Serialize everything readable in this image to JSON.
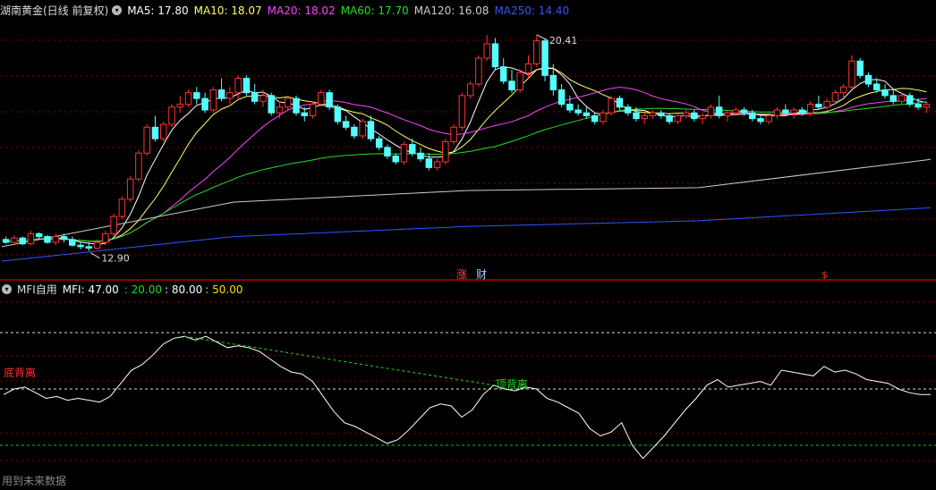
{
  "main_header": {
    "title": "湖南黄金(日线 前复权)",
    "ma": [
      {
        "label": "MA5: 17.80",
        "color": "#ffffff"
      },
      {
        "label": "MA10: 18.07",
        "color": "#ffff66"
      },
      {
        "label": "MA20: 18.02",
        "color": "#ff44ff"
      },
      {
        "label": "MA60: 17.70",
        "color": "#22dd22"
      },
      {
        "label": "MA120: 16.08",
        "color": "#cccccc"
      },
      {
        "label": "MA250: 14.40",
        "color": "#3355ff"
      }
    ]
  },
  "markers": {
    "high": "20.41",
    "low": "12.90",
    "tag_zhang": "涨",
    "tag_cai": "财",
    "tag_s": "$"
  },
  "mfi_header": {
    "name": "MFI自用",
    "mfi": "MFI: 47.00",
    "v1": ": 20.00",
    "v2": ": 80.00",
    "v3": ": 50.00",
    "colors": {
      "mfi": "#ffffff",
      "v1": "#22dd22",
      "v2": "#ffffff",
      "v3": "#ffdd00"
    }
  },
  "annotations": {
    "bottom_div": "底背离",
    "top_div": "顶背离"
  },
  "footer": "用到未来数据",
  "colors": {
    "up": "#ff3333",
    "down": "#55ffff",
    "grid": "#8b0000",
    "ma5": "#ffffff",
    "ma10": "#ffff66",
    "ma20": "#ff44ff",
    "ma60": "#22dd22",
    "ma120": "#cccccc",
    "ma250": "#3355ff"
  },
  "chart_data": [
    {
      "type": "candlestick",
      "candles": [
        [
          13.3,
          13.4,
          13.15,
          13.2
        ],
        [
          13.2,
          13.45,
          13.1,
          13.35
        ],
        [
          13.35,
          13.4,
          13.1,
          13.15
        ],
        [
          13.15,
          13.6,
          13.1,
          13.5
        ],
        [
          13.5,
          13.55,
          13.3,
          13.4
        ],
        [
          13.4,
          13.45,
          13.15,
          13.2
        ],
        [
          13.2,
          13.5,
          13.1,
          13.4
        ],
        [
          13.4,
          13.5,
          13.2,
          13.3
        ],
        [
          13.3,
          13.4,
          13.05,
          13.1
        ],
        [
          13.1,
          13.2,
          12.95,
          13.05
        ],
        [
          13.05,
          13.2,
          12.9,
          13.0
        ],
        [
          13.0,
          13.3,
          12.95,
          13.2
        ],
        [
          13.2,
          13.6,
          13.1,
          13.5
        ],
        [
          13.5,
          14.2,
          13.4,
          14.1
        ],
        [
          14.1,
          14.8,
          14.0,
          14.7
        ],
        [
          14.7,
          15.5,
          14.6,
          15.4
        ],
        [
          15.4,
          16.4,
          15.3,
          16.3
        ],
        [
          16.3,
          17.3,
          16.2,
          17.2
        ],
        [
          17.2,
          17.6,
          16.7,
          16.8
        ],
        [
          16.8,
          17.4,
          16.7,
          17.3
        ],
        [
          17.3,
          18.0,
          17.2,
          17.9
        ],
        [
          17.9,
          18.3,
          17.7,
          18.0
        ],
        [
          18.0,
          18.5,
          17.9,
          18.4
        ],
        [
          18.4,
          18.6,
          18.0,
          18.2
        ],
        [
          18.2,
          18.4,
          17.7,
          17.8
        ],
        [
          17.8,
          18.6,
          17.7,
          18.5
        ],
        [
          18.5,
          18.9,
          18.1,
          18.2
        ],
        [
          18.2,
          18.6,
          18.0,
          18.4
        ],
        [
          18.4,
          19.0,
          18.2,
          18.9
        ],
        [
          18.9,
          19.0,
          18.3,
          18.4
        ],
        [
          18.4,
          18.7,
          18.0,
          18.1
        ],
        [
          18.1,
          18.5,
          17.9,
          18.3
        ],
        [
          18.3,
          18.4,
          17.6,
          17.7
        ],
        [
          17.7,
          18.1,
          17.5,
          17.9
        ],
        [
          17.9,
          18.3,
          17.8,
          18.2
        ],
        [
          18.2,
          18.3,
          17.6,
          17.7
        ],
        [
          17.7,
          17.9,
          17.4,
          17.6
        ],
        [
          17.6,
          18.1,
          17.5,
          18.0
        ],
        [
          18.0,
          18.5,
          17.9,
          18.4
        ],
        [
          18.4,
          18.5,
          17.8,
          17.9
        ],
        [
          17.9,
          18.0,
          17.3,
          17.4
        ],
        [
          17.4,
          17.6,
          17.1,
          17.2
        ],
        [
          17.2,
          17.3,
          16.8,
          16.9
        ],
        [
          16.9,
          17.5,
          16.8,
          17.4
        ],
        [
          17.4,
          17.6,
          16.7,
          16.8
        ],
        [
          16.8,
          16.9,
          16.4,
          16.5
        ],
        [
          16.5,
          16.6,
          16.1,
          16.2
        ],
        [
          16.2,
          16.3,
          15.9,
          16.0
        ],
        [
          16.0,
          16.7,
          15.9,
          16.6
        ],
        [
          16.6,
          16.8,
          16.2,
          16.3
        ],
        [
          16.3,
          16.5,
          16.0,
          16.1
        ],
        [
          16.1,
          16.3,
          15.7,
          15.8
        ],
        [
          15.8,
          16.1,
          15.7,
          16.0
        ],
        [
          16.0,
          16.8,
          15.9,
          16.7
        ],
        [
          16.7,
          17.3,
          16.6,
          17.2
        ],
        [
          17.2,
          18.4,
          17.1,
          18.3
        ],
        [
          18.3,
          18.8,
          18.2,
          18.7
        ],
        [
          18.7,
          19.7,
          18.6,
          19.6
        ],
        [
          19.6,
          20.4,
          19.5,
          20.1
        ],
        [
          20.1,
          20.3,
          19.2,
          19.3
        ],
        [
          19.3,
          19.6,
          18.7,
          18.8
        ],
        [
          18.8,
          19.2,
          18.4,
          18.5
        ],
        [
          18.5,
          19.2,
          18.4,
          19.1
        ],
        [
          19.1,
          19.7,
          18.9,
          19.4
        ],
        [
          19.4,
          20.41,
          19.3,
          20.2
        ],
        [
          20.2,
          20.3,
          18.8,
          19.0
        ],
        [
          19.0,
          19.4,
          18.3,
          18.5
        ],
        [
          18.5,
          18.7,
          17.9,
          18.0
        ],
        [
          18.0,
          18.3,
          17.7,
          17.8
        ],
        [
          17.8,
          18.0,
          17.6,
          17.7
        ],
        [
          17.7,
          17.9,
          17.5,
          17.6
        ],
        [
          17.6,
          17.7,
          17.3,
          17.4
        ],
        [
          17.4,
          17.8,
          17.3,
          17.7
        ],
        [
          17.7,
          18.3,
          17.6,
          18.2
        ],
        [
          18.2,
          18.3,
          17.8,
          17.9
        ],
        [
          17.9,
          18.0,
          17.6,
          17.7
        ],
        [
          17.7,
          17.9,
          17.4,
          17.5
        ],
        [
          17.5,
          17.7,
          17.3,
          17.6
        ],
        [
          17.6,
          17.8,
          17.5,
          17.7
        ],
        [
          17.7,
          17.8,
          17.5,
          17.6
        ],
        [
          17.6,
          17.7,
          17.3,
          17.4
        ],
        [
          17.4,
          17.7,
          17.3,
          17.6
        ],
        [
          17.6,
          17.8,
          17.5,
          17.7
        ],
        [
          17.7,
          17.8,
          17.4,
          17.5
        ],
        [
          17.5,
          17.7,
          17.3,
          17.6
        ],
        [
          17.6,
          18.0,
          17.5,
          17.9
        ],
        [
          17.9,
          18.3,
          17.5,
          17.6
        ],
        [
          17.6,
          17.8,
          17.4,
          17.7
        ],
        [
          17.7,
          17.9,
          17.6,
          17.8
        ],
        [
          17.8,
          17.9,
          17.6,
          17.7
        ],
        [
          17.7,
          17.8,
          17.4,
          17.5
        ],
        [
          17.5,
          17.6,
          17.3,
          17.4
        ],
        [
          17.4,
          17.7,
          17.3,
          17.6
        ],
        [
          17.6,
          17.9,
          17.5,
          17.8
        ],
        [
          17.8,
          18.0,
          17.6,
          17.7
        ],
        [
          17.7,
          17.9,
          17.5,
          17.8
        ],
        [
          17.8,
          17.9,
          17.6,
          17.7
        ],
        [
          17.7,
          18.1,
          17.6,
          18.0
        ],
        [
          18.0,
          18.3,
          17.8,
          17.9
        ],
        [
          17.9,
          18.2,
          17.8,
          18.1
        ],
        [
          18.1,
          18.5,
          18.0,
          18.4
        ],
        [
          18.4,
          18.7,
          18.2,
          18.6
        ],
        [
          18.6,
          19.7,
          18.5,
          19.5
        ],
        [
          19.5,
          19.6,
          18.9,
          19.0
        ],
        [
          19.0,
          19.1,
          18.6,
          18.7
        ],
        [
          18.7,
          18.9,
          18.4,
          18.5
        ],
        [
          18.5,
          18.7,
          18.2,
          18.3
        ],
        [
          18.3,
          18.5,
          18.0,
          18.1
        ],
        [
          18.1,
          18.4,
          18.0,
          18.3
        ],
        [
          18.3,
          18.4,
          17.9,
          18.0
        ],
        [
          18.0,
          18.2,
          17.8,
          17.9
        ],
        [
          17.9,
          18.1,
          17.7,
          18.0
        ]
      ],
      "ylim": [
        12.3,
        21.0
      ],
      "ma": [
        {
          "name": "MA5",
          "window": 5
        },
        {
          "name": "MA10",
          "window": 10
        },
        {
          "name": "MA20",
          "window": 20
        },
        {
          "name": "MA60",
          "window": 60
        },
        {
          "name": "MA120",
          "values": [
            13.05,
            14.6,
            15.0,
            15.1,
            16.08
          ]
        },
        {
          "name": "MA250",
          "values": [
            12.55,
            13.4,
            13.75,
            13.95,
            14.4
          ]
        }
      ]
    },
    {
      "type": "line",
      "series": [
        {
          "name": "MFI",
          "values": [
            47,
            50,
            51,
            48,
            45,
            46,
            44,
            45,
            44,
            43,
            46,
            53,
            60,
            63,
            68,
            74,
            77,
            78,
            76,
            78,
            75,
            72,
            73,
            72,
            70,
            66,
            62,
            59,
            58,
            54,
            46,
            38,
            32,
            30,
            27,
            24,
            21,
            23,
            28,
            34,
            40,
            42,
            41,
            35,
            39,
            47,
            52,
            50,
            49,
            51,
            50,
            45,
            43,
            40,
            37,
            29,
            25,
            27,
            32,
            20,
            13,
            19,
            25,
            32,
            39,
            45,
            52,
            55,
            51,
            52,
            53,
            54,
            52,
            60,
            59,
            58,
            57,
            62,
            59,
            60,
            58,
            55,
            54,
            53,
            50,
            48,
            47,
            47
          ]
        }
      ],
      "ylim": [
        0,
        100
      ],
      "levels": [
        20,
        50,
        80
      ]
    }
  ]
}
